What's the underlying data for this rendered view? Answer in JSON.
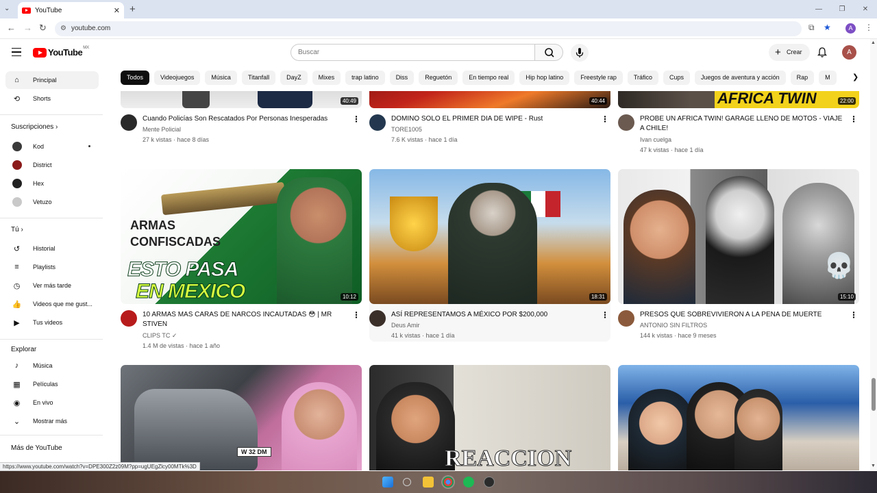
{
  "browser": {
    "tab_title": "YouTube",
    "url": "youtube.com",
    "status_url": "https://www.youtube.com/watch?v=DPE300Z2z09M?pp=ugUEgZlcy00MTk%3D",
    "profile_letter": "A"
  },
  "header": {
    "logo_text": "YouTube",
    "region": "MX",
    "search_placeholder": "Buscar",
    "create_label": "Crear",
    "avatar_letter": "A"
  },
  "chips": [
    "Todos",
    "Videojuegos",
    "Música",
    "Titanfall",
    "DayZ",
    "Mixes",
    "trap latino",
    "Diss",
    "Reguetón",
    "En tiempo real",
    "Hip hop latino",
    "Freestyle rap",
    "Tráfico",
    "Cups",
    "Juegos de aventura y acción",
    "Rap",
    "M"
  ],
  "sidebar": {
    "principal": "Principal",
    "shorts": "Shorts",
    "subs_title": "Suscripciones",
    "subs": [
      {
        "name": "Kod",
        "color": "#3a3a3a"
      },
      {
        "name": "District",
        "color": "#8b1a1a"
      },
      {
        "name": "Hex",
        "color": "#222222"
      },
      {
        "name": "Vetuzo",
        "color": "#c9c9c9"
      }
    ],
    "you_title": "Tú",
    "you_items": [
      "Historial",
      "Playlists",
      "Ver más tarde",
      "Videos que me gust...",
      "Tus videos"
    ],
    "explore_title": "Explorar",
    "explore_items": [
      "Música",
      "Películas",
      "En vivo",
      "Mostrar más"
    ],
    "more_title": "Más de YouTube"
  },
  "videos_row1": [
    {
      "title": "Cuando Policías Son Rescatados Por Personas Inesperadas",
      "channel": "Mente Policial",
      "stats": "27 k vistas · hace 8 días",
      "duration": "40:49"
    },
    {
      "title": "DOMINO SOLO EL PRIMER DIA DE WIPE - Rust",
      "channel": "TORE1005",
      "stats": "7.6 K vistas · hace 1 día",
      "duration": "40:44"
    },
    {
      "title": "PROBE UN AFRICA TWIN! GARAGE LLENO DE MOTOS - VIAJE A CHILE!",
      "channel": "Ivan cuelga",
      "stats": "47 k vistas · hace 1 día",
      "duration": "22:00",
      "thumb_text": "AFRICA TWIN"
    }
  ],
  "videos_row2": [
    {
      "title": "10 ARMAS MAS CARAS DE NARCOS INCAUTADAS 😳 | MR STIVEN",
      "channel": "CLIPS TC",
      "stats": "1.4 M de vistas · hace 1 año",
      "duration": "10:12",
      "thumb_top": "ARMAS",
      "thumb_top2": "CONFISCADAS",
      "thumb_big1": "ESTO PASA",
      "thumb_big2": "EN MEXICO"
    },
    {
      "title": "ASÍ REPRESENTAMOS A MÉXICO POR $200,000",
      "channel": "Deus Amir",
      "stats": "41 k vistas · hace 1 día",
      "duration": "18:31"
    },
    {
      "title": "PRESOS QUE SOBREVIVIERON A LA PENA DE MUERTE",
      "channel": "ANTONIO SIN FILTROS",
      "stats": "144 k vistas · hace 9 meses",
      "duration": "15:10"
    }
  ],
  "videos_row3": [
    {
      "plate": "W 32 DM"
    },
    {
      "thumb_text": "REACCION"
    },
    {}
  ]
}
